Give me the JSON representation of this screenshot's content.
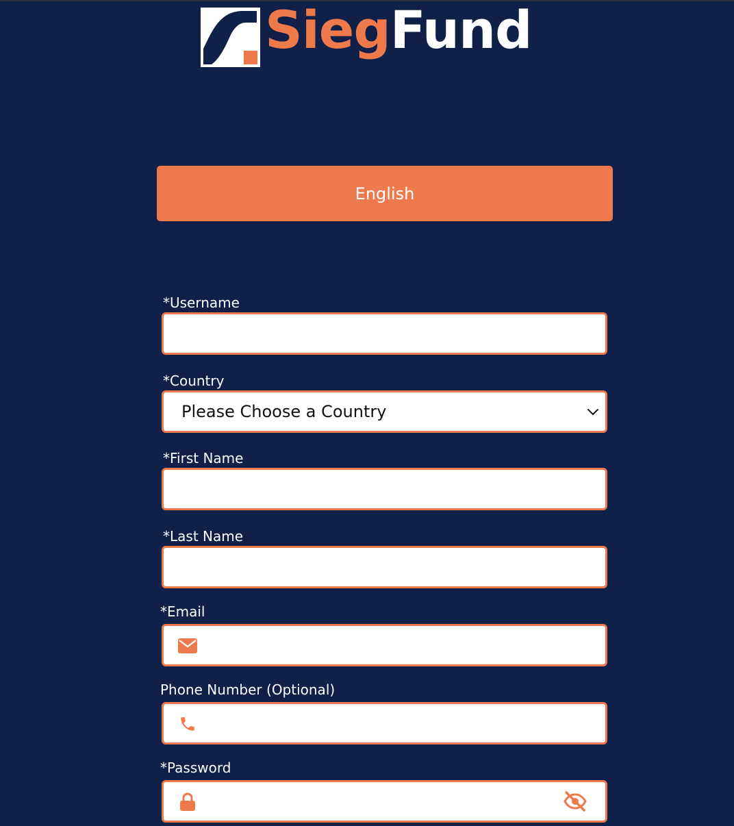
{
  "brand": {
    "name_part1": "Sieg",
    "name_part2": "Fund"
  },
  "language": {
    "label": "English"
  },
  "form": {
    "username": {
      "label": "*Username",
      "value": ""
    },
    "country": {
      "label": "*Country",
      "selected": "Please Choose a Country"
    },
    "first_name": {
      "label": "*First Name",
      "value": ""
    },
    "last_name": {
      "label": "*Last Name",
      "value": ""
    },
    "email": {
      "label": "*Email",
      "value": "",
      "icon": "envelope-icon"
    },
    "phone": {
      "label": "Phone Number (Optional)",
      "value": "",
      "icon": "phone-icon"
    },
    "password": {
      "label": "*Password",
      "value": "",
      "icon": "lock-icon",
      "toggle_icon": "eye-slash-icon"
    }
  },
  "colors": {
    "background": "#112048",
    "accent": "#ed7a4c",
    "field_bg": "#ffffff"
  }
}
